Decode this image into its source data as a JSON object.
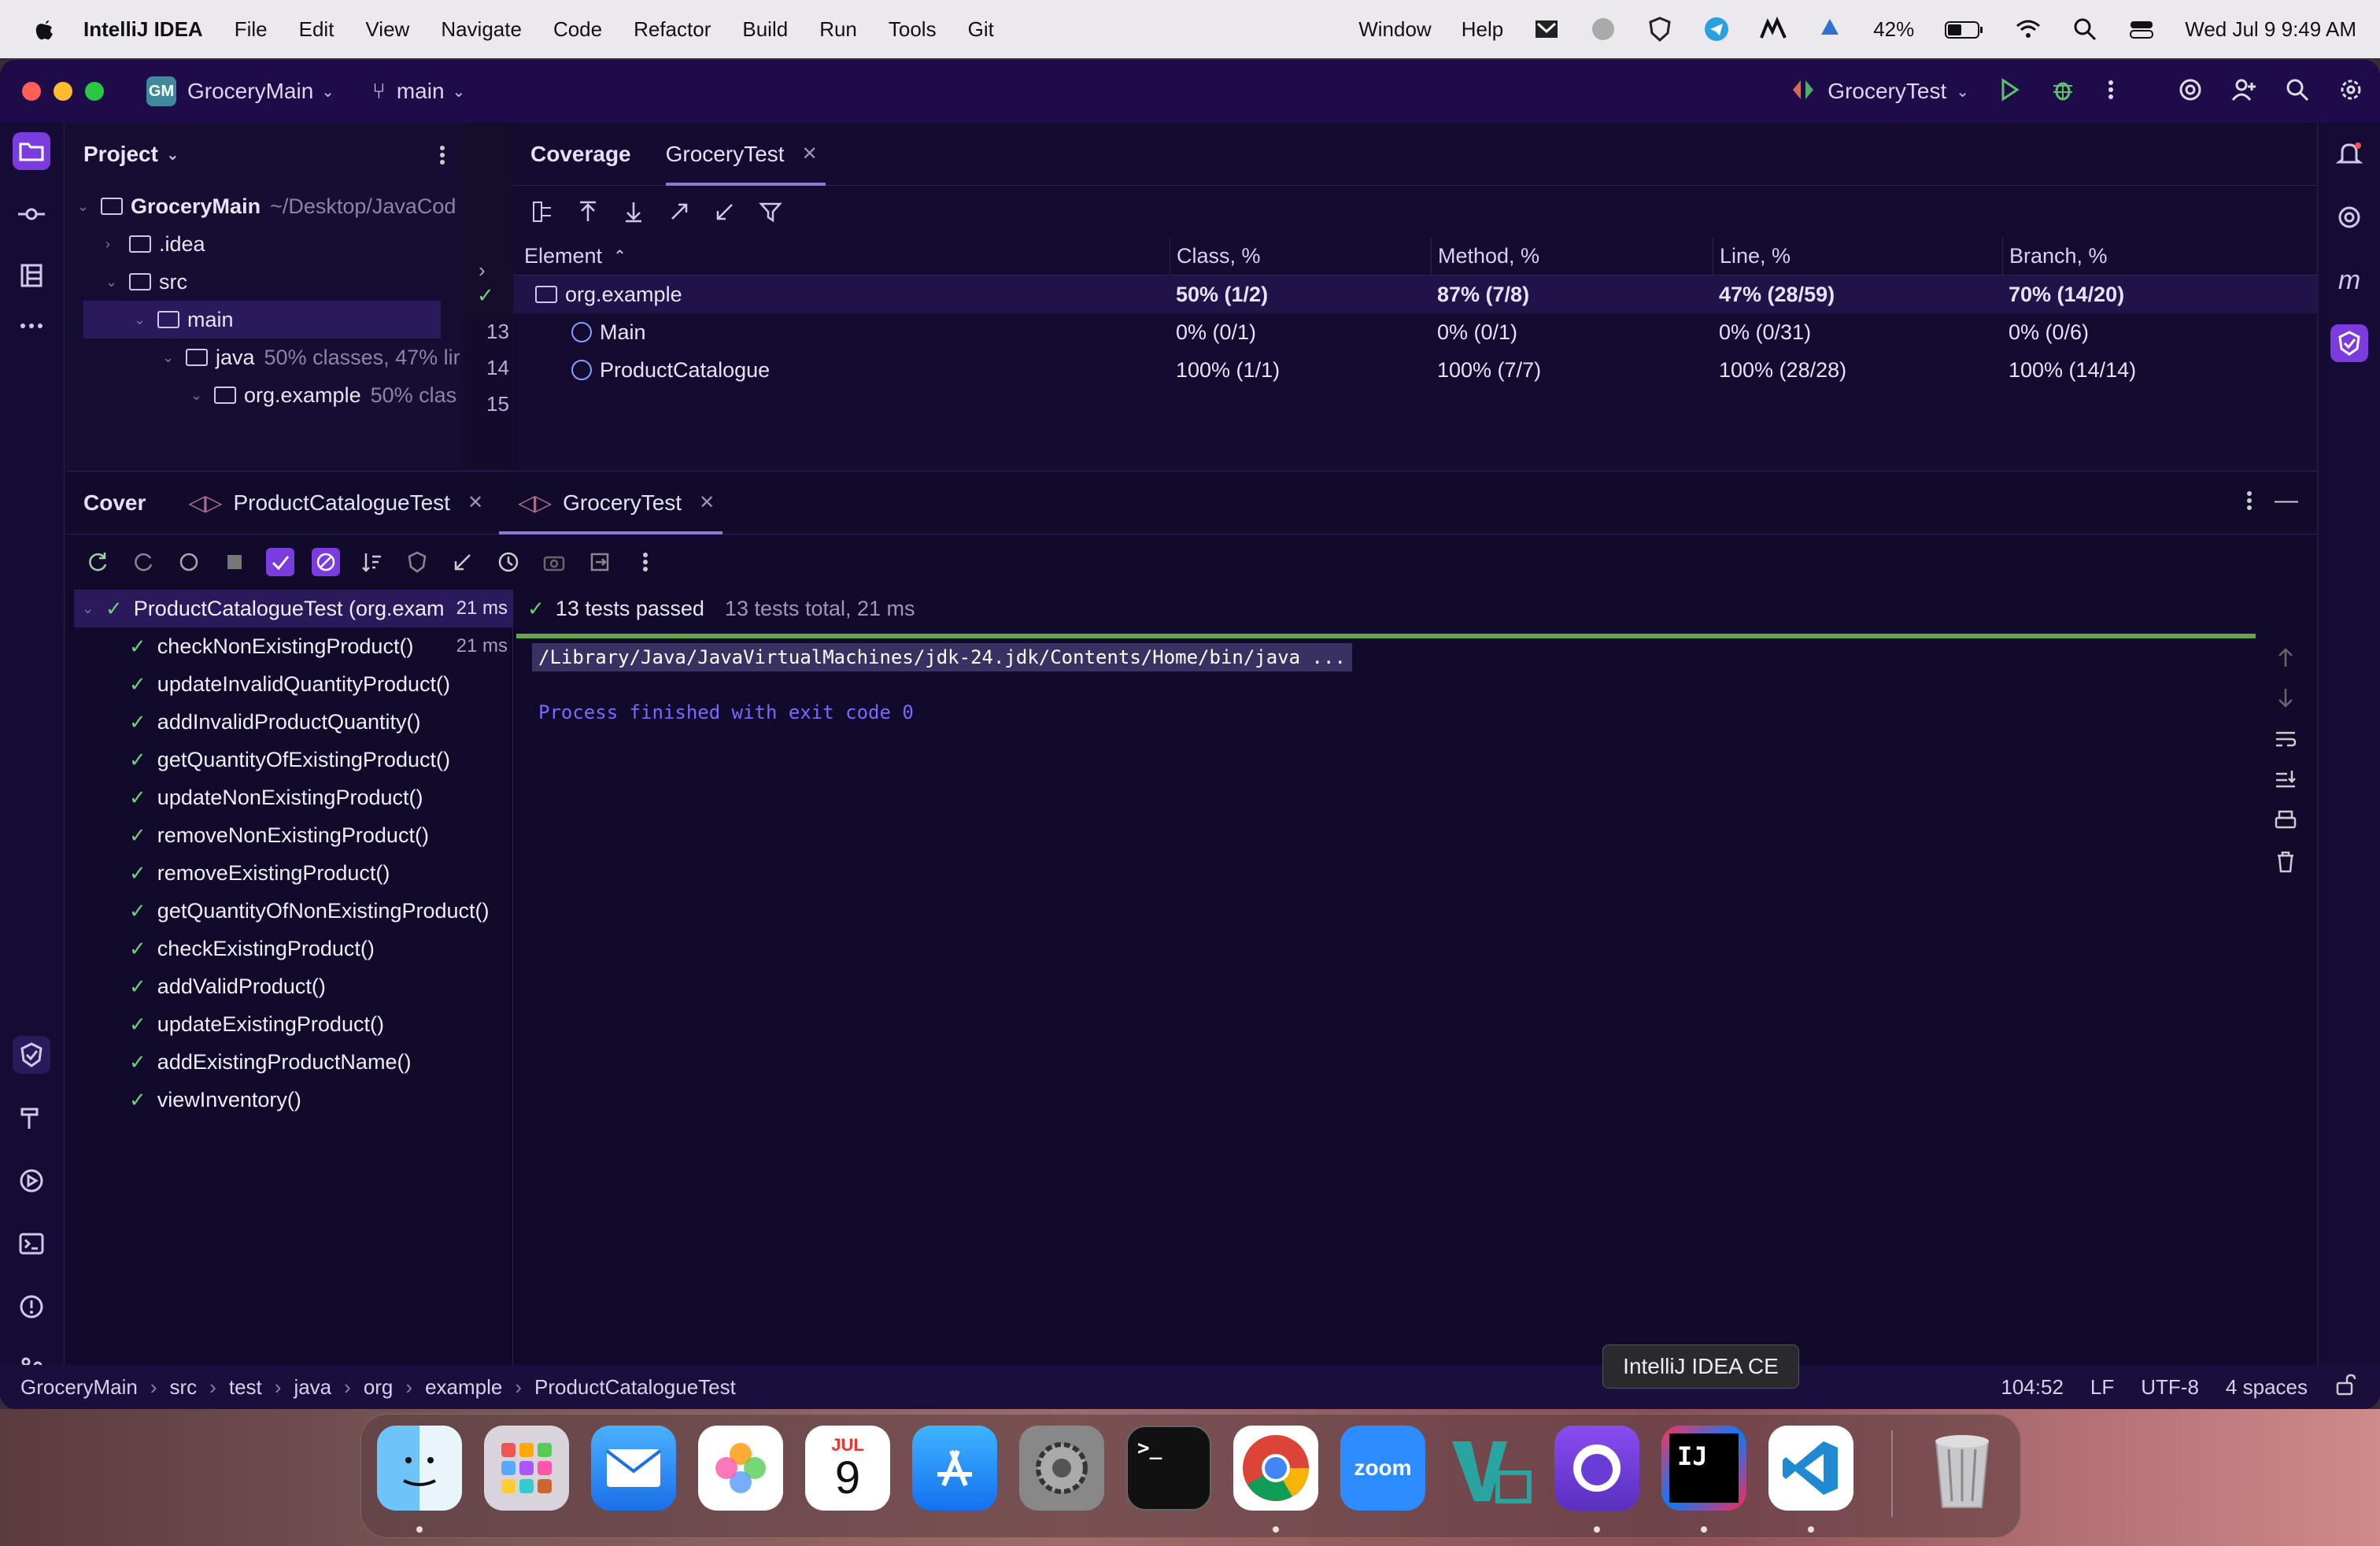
{
  "menubar": {
    "app_name": "IntelliJ IDEA",
    "items": [
      "File",
      "Edit",
      "View",
      "Navigate",
      "Code",
      "Refactor",
      "Build",
      "Run",
      "Tools",
      "Git"
    ],
    "right_items": [
      "Window",
      "Help"
    ],
    "battery": "42%",
    "datetime": "Wed Jul 9  9:49 AM"
  },
  "titlebar": {
    "project_badge": "GM",
    "project_name": "GroceryMain",
    "branch": "main",
    "run_config": "GroceryTest"
  },
  "project_panel": {
    "title": "Project",
    "tree": [
      {
        "label": "GroceryMain",
        "detail": "~/Desktop/JavaCod"
      },
      {
        "label": ".idea",
        "detail": ""
      },
      {
        "label": "src",
        "detail": ""
      },
      {
        "label": "main",
        "detail": ""
      },
      {
        "label": "java",
        "detail": "50% classes, 47% lir"
      },
      {
        "label": "org.example",
        "detail": "50% clas"
      }
    ]
  },
  "gutter": {
    "lines": [
      "13",
      "14",
      "15"
    ]
  },
  "coverage": {
    "tabs": [
      {
        "label": "Coverage"
      },
      {
        "label": "GroceryTest"
      }
    ],
    "headers": [
      "Element",
      "Class, %",
      "Method, %",
      "Line, %",
      "Branch, %"
    ],
    "rows": [
      {
        "element": "org.example",
        "class": "50% (1/2)",
        "method": "87% (7/8)",
        "line": "47% (28/59)",
        "branch": "70% (14/20)"
      },
      {
        "element": "Main",
        "class": "0% (0/1)",
        "method": "0% (0/1)",
        "line": "0% (0/31)",
        "branch": "0% (0/6)"
      },
      {
        "element": "ProductCatalogue",
        "class": "100% (1/1)",
        "method": "100% (7/7)",
        "line": "100% (28/28)",
        "branch": "100% (14/14)"
      }
    ]
  },
  "run": {
    "tabs": [
      "Cover",
      "ProductCatalogueTest",
      "GroceryTest"
    ],
    "root": {
      "label": "ProductCatalogueTest (org.exam",
      "time": "21 ms"
    },
    "tests": [
      {
        "label": "checkNonExistingProduct()",
        "time": "21 ms"
      },
      {
        "label": "updateInvalidQuantityProduct()",
        "time": ""
      },
      {
        "label": "addInvalidProductQuantity()",
        "time": ""
      },
      {
        "label": "getQuantityOfExistingProduct()",
        "time": ""
      },
      {
        "label": "updateNonExistingProduct()",
        "time": ""
      },
      {
        "label": "removeNonExistingProduct()",
        "time": ""
      },
      {
        "label": "removeExistingProduct()",
        "time": ""
      },
      {
        "label": "getQuantityOfNonExistingProduct()",
        "time": ""
      },
      {
        "label": "checkExistingProduct()",
        "time": ""
      },
      {
        "label": "addValidProduct()",
        "time": ""
      },
      {
        "label": "updateExistingProduct()",
        "time": ""
      },
      {
        "label": "addExistingProductName()",
        "time": ""
      },
      {
        "label": "viewInventory()",
        "time": ""
      }
    ],
    "status": "13 tests passed",
    "summary": "13 tests total, 21 ms",
    "command": "/Library/Java/JavaVirtualMachines/jdk-24.jdk/Contents/Home/bin/java ...",
    "process_msg": "Process finished with exit code 0"
  },
  "statusbar": {
    "breadcrumbs": [
      "GroceryMain",
      "src",
      "test",
      "java",
      "org",
      "example",
      "ProductCatalogueTest"
    ],
    "position": "104:52",
    "line_sep": "LF",
    "encoding": "UTF-8",
    "indent": "4 spaces",
    "tooltip": "IntelliJ IDEA CE"
  },
  "dock": {
    "calendar_month": "JUL",
    "calendar_day": "9",
    "zoom_label": "zoom",
    "terminal_label": ">_",
    "ij_label": "IJ"
  }
}
